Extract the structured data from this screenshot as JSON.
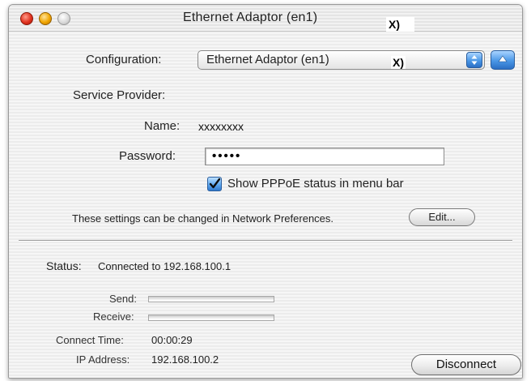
{
  "window": {
    "title": "Ethernet Adaptor (en1)",
    "title_suffix": "X)",
    "controls": {
      "close_color": "#e0321f",
      "minimize_color": "#f0a500",
      "zoom_color": "#d6d6d6"
    }
  },
  "configuration": {
    "label": "Configuration:",
    "selected": "Ethernet Adaptor (en1)",
    "selected_suffix": "X)",
    "popup_icon": "up-down-arrows-icon",
    "eject_icon": "eject-icon"
  },
  "service_provider": {
    "label": "Service Provider:"
  },
  "name": {
    "label": "Name:",
    "value": "xxxxxxxx"
  },
  "password": {
    "label": "Password:",
    "value": "•••••"
  },
  "pppoe_status": {
    "label": "Show PPPoE status in menu bar",
    "checked": true,
    "check_icon": "checkmark-icon"
  },
  "note": {
    "text": "These settings can be changed in Network Preferences.",
    "edit_label": "Edit..."
  },
  "status": {
    "label": "Status:",
    "value": "Connected to 192.168.100.1"
  },
  "send": {
    "label": "Send:",
    "level": 0
  },
  "receive": {
    "label": "Receive:",
    "level": 0
  },
  "connect_time": {
    "label": "Connect Time:",
    "value": "00:00:29"
  },
  "ip_address": {
    "label": "IP Address:",
    "value": "192.168.100.2"
  },
  "disconnect": {
    "label": "Disconnect"
  },
  "colors": {
    "accent_blue": "#4a97e6",
    "window_bg": "#ececec",
    "text": "#222222"
  }
}
